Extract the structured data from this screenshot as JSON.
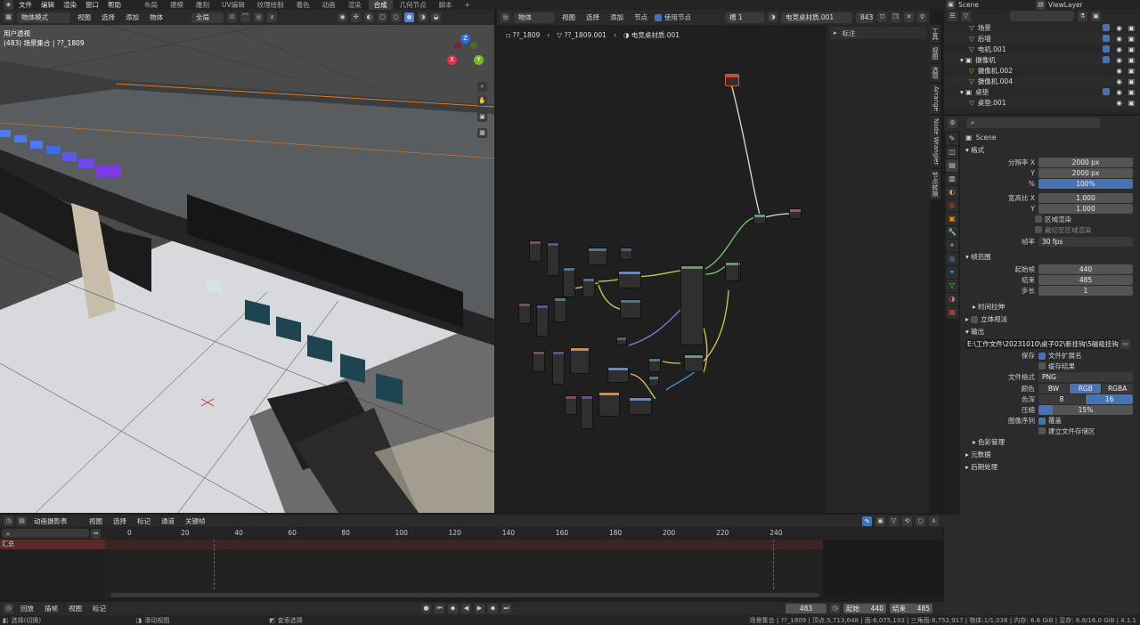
{
  "topbar": {
    "menus": [
      "文件",
      "编辑",
      "渲染",
      "窗口",
      "帮助"
    ],
    "workspaces": [
      "布局",
      "建模",
      "雕刻",
      "UV编辑",
      "纹理绘制",
      "着色",
      "动画",
      "渲染",
      "合成",
      "几何节点",
      "脚本"
    ],
    "active": "合成",
    "plus": "+"
  },
  "scene": {
    "name": "Scene",
    "viewlayer": "ViewLayer"
  },
  "viewport": {
    "mode": "物体模式",
    "menus": [
      "视图",
      "选择",
      "添加",
      "物体"
    ],
    "orient": "全局",
    "view_label": "用户透视",
    "collection": "(483) 场景集合 | ??_1809",
    "gizmo": {
      "x": "X",
      "y": "Y",
      "z": "Z"
    }
  },
  "node_editor": {
    "type": "物体",
    "menus": [
      "视图",
      "选择",
      "添加",
      "节点"
    ],
    "use_nodes": "使用节点",
    "slot": "槽 1",
    "material": "电竞桌材质.001",
    "users": "843",
    "crumbs": [
      "??_1809",
      "??_1809.001",
      "电竞桌材质.001"
    ],
    "side_panel": "标注",
    "tabs": [
      "工具",
      "视图",
      "选项",
      "Arrange",
      "Node Wrangler",
      "节点转换"
    ]
  },
  "outliner": {
    "search": "",
    "rows": [
      {
        "name": "场景",
        "indent": 2,
        "cb": true
      },
      {
        "name": "后墙",
        "indent": 2,
        "cb": true
      },
      {
        "name": "电机.001",
        "indent": 2,
        "cb": true
      },
      {
        "name": "摄像机",
        "indent": 1,
        "cb": true
      },
      {
        "name": "摄像机.002",
        "indent": 2,
        "cb": false
      },
      {
        "name": "摄像机.004",
        "indent": 2,
        "cb": false
      },
      {
        "name": "桌垫",
        "indent": 1,
        "cb": true
      },
      {
        "name": "桌垫.001",
        "indent": 2,
        "cb": false
      }
    ]
  },
  "props": {
    "scene": "Scene",
    "format": {
      "title": "格式",
      "res_x_label": "分辨率 X",
      "res_x": "2000 px",
      "res_y_label": "Y",
      "res_y": "2000 px",
      "pct_label": "%",
      "pct": "100%",
      "aspect_x_label": "宽高比 X",
      "aspect_x": "1.000",
      "aspect_y_label": "Y",
      "aspect_y": "1.000",
      "region": "区域渲染",
      "crop": "裁切至区域渲染",
      "fps_label": "帧率",
      "fps": "30 fps"
    },
    "frame_range": {
      "title": "帧范围",
      "start_label": "起始帧",
      "start": "440",
      "end_label": "结束",
      "end": "485",
      "step_label": "步长",
      "step": "1"
    },
    "time_stretch": "时间拉伸",
    "stereo": "立体视法",
    "output": {
      "title": "输出",
      "path": "E:\\工作文件\\20231010\\桌子02\\新挂钩\\5磁吸挂钩预...",
      "save_label": "保存",
      "file_ext": "文件扩展名",
      "cache": "缓存结果",
      "format_label": "文件格式",
      "format": "PNG",
      "color_label": "颜色",
      "bw": "BW",
      "rgb": "RGB",
      "rgba": "RGBA",
      "depth_label": "色深",
      "d8": "8",
      "d16": "16",
      "comp_label": "压缩",
      "comp": "15%",
      "seq_label": "图像序列",
      "overwrite": "覆盖",
      "placeholders": "建立文件存储区",
      "color_mgmt": "色彩管理"
    },
    "metadata": "元数据",
    "post": "后期处理"
  },
  "timeline": {
    "editor": "动画摄影表",
    "menus": [
      "视图",
      "选择",
      "标记",
      "通道",
      "关键帧"
    ],
    "ticks": [
      "0",
      "20",
      "40",
      "60",
      "80",
      "100",
      "120",
      "140",
      "160",
      "180",
      "200",
      "220",
      "240"
    ],
    "summary": "汇总",
    "current": "483",
    "foot_menus": [
      "回放",
      "插帧",
      "视图",
      "标记"
    ],
    "start_label": "起始",
    "start": "440",
    "end_label": "结束",
    "end": "485"
  },
  "status": {
    "left1": "选择(切换)",
    "left2": "滑动视图",
    "left3": "套索选择",
    "right": "场景集合 | ??_1809 | 顶点:5,713,648 | 面:6,075,193 | 三角面:8,752,917 | 物体:1/1,038 | 内存: 6.8 GiB | 显存: 6.8/16.0 GiB | 4.1.1"
  }
}
